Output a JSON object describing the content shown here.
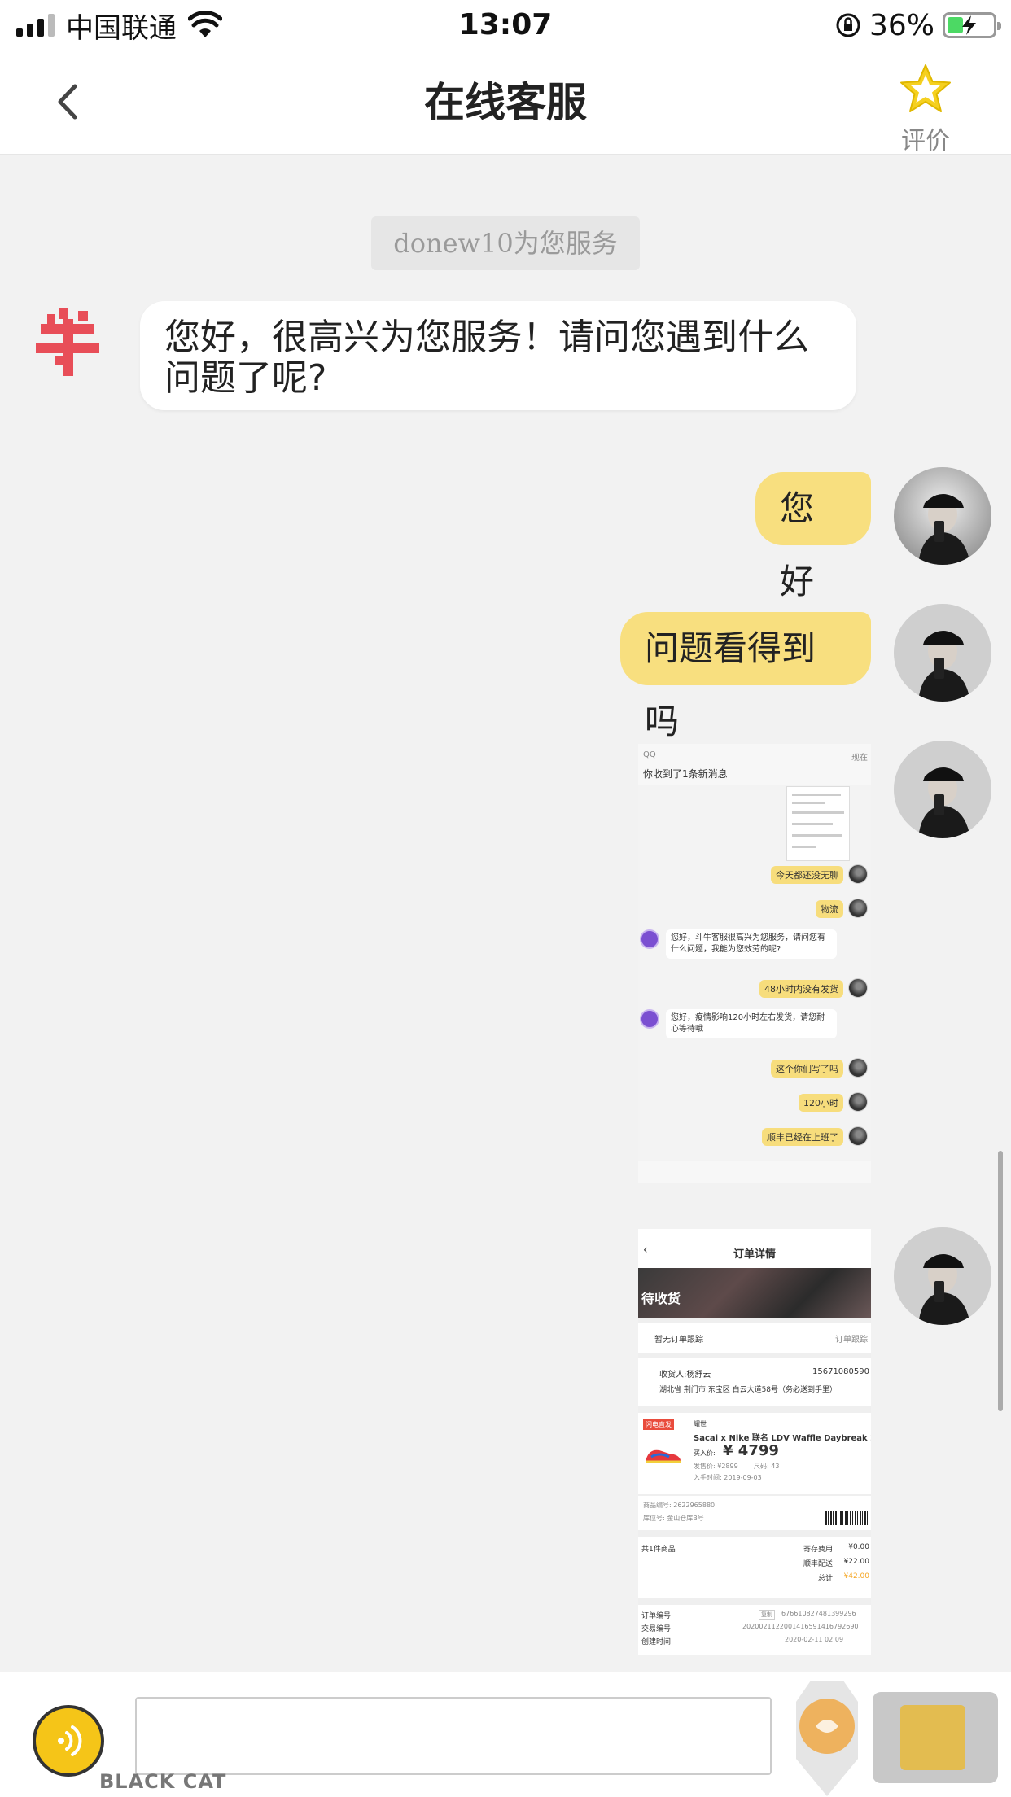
{
  "status_bar": {
    "carrier": "中国联通",
    "time": "13:07",
    "battery_percent": "36%",
    "battery_level": 0.36
  },
  "nav": {
    "title": "在线客服",
    "rate_label": "评价"
  },
  "chat": {
    "service_notice": "donew10为您服务",
    "agent_message": "您好，很高兴为您服务！请问您遇到什么问题了呢?",
    "user_messages": [
      "您好",
      "问题看得到吗"
    ]
  },
  "screenshot_1": {
    "notification_app": "QQ",
    "notification_time": "现在",
    "notification_text": "你收到了1条新消息",
    "messages": [
      {
        "from": "user",
        "text": "今天都还没无聊"
      },
      {
        "from": "user",
        "text": "物流"
      },
      {
        "from": "agent",
        "text": "您好，斗牛客服很高兴为您服务，请问您有什么问题，我能为您效劳的呢?"
      },
      {
        "from": "user",
        "text": "48小时内没有发货"
      },
      {
        "from": "agent",
        "text": "您好，疫情影响120小时左右发货，请您耐心等待哦"
      },
      {
        "from": "user",
        "text": "这个你们写了吗"
      },
      {
        "from": "user",
        "text": "120小时"
      },
      {
        "from": "user",
        "text": "顺丰已经在上班了"
      }
    ]
  },
  "screenshot_2": {
    "title": "订单详情",
    "status": "待收货",
    "tracking": "暂无订单跟踪",
    "tracking_link": "订单跟踪",
    "recipient": "收货人:杨舒云",
    "phone": "15671080590",
    "address": "湖北省 荆门市 东宝区 白云大道58号（务必送到手里）",
    "tag": "闪电直发",
    "brand_tag": "耀世",
    "product_name": "Sacai x Nike 联名 LDV Waffle Daybreak 2...",
    "buy_price_label": "买入价:",
    "price": "¥ 4799",
    "sale_price": "发售价: ¥2899",
    "size": "尺码: 43",
    "buy_time": "入手时间: 2019-09-03",
    "product_no": "商品编号: 2622965880",
    "storage_no": "库位号: 金山仓库B号",
    "count": "共1件商品",
    "fee_labels": [
      "寄存费用:",
      "顺丰配送:",
      "总计:"
    ],
    "fee_values": [
      "¥0.00",
      "¥22.00",
      "¥42.00"
    ],
    "order_labels": [
      "订单编号",
      "交易编号",
      "创建时间"
    ],
    "order_values": [
      "676610827481399296",
      "2020021122001416591416792690",
      "2020-02-11 02:09"
    ],
    "copy_label": "复制"
  },
  "watermark": {
    "text": "BLACK CAT"
  },
  "colors": {
    "user_bubble": "#f8df7f",
    "accent_yellow": "#f5c518",
    "background": "#f2f2f2"
  },
  "icons": [
    "signal-icon",
    "wifi-icon",
    "orientation-lock-icon",
    "battery-icon",
    "back-chevron-icon",
    "star-icon",
    "voice-icon"
  ]
}
